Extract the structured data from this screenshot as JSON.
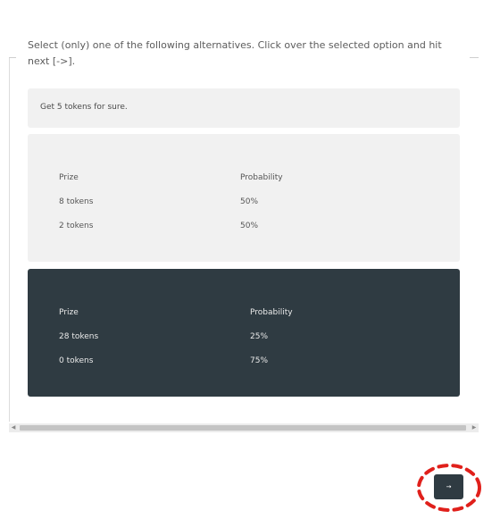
{
  "instruction": "Select (only) one of the following alternatives. Click over the selected option and hit next [->].",
  "options": [
    {
      "type": "sure",
      "text": "Get 5 tokens for sure."
    },
    {
      "type": "lottery",
      "selected": false,
      "headers": {
        "prize": "Prize",
        "probability": "Probability"
      },
      "rows": [
        {
          "prize": "8 tokens",
          "probability": "50%"
        },
        {
          "prize": "2 tokens",
          "probability": "50%"
        }
      ]
    },
    {
      "type": "lottery",
      "selected": true,
      "headers": {
        "prize": "Prize",
        "probability": "Probability"
      },
      "rows": [
        {
          "prize": "28 tokens",
          "probability": "25%"
        },
        {
          "prize": "0 tokens",
          "probability": "75%"
        }
      ]
    }
  ],
  "next_button": {
    "label": "→",
    "icon": "arrow-right-icon"
  },
  "colors": {
    "selected_bg": "#2f3b42",
    "option_bg": "#f1f1f1",
    "highlight_ring": "#e0201b"
  }
}
